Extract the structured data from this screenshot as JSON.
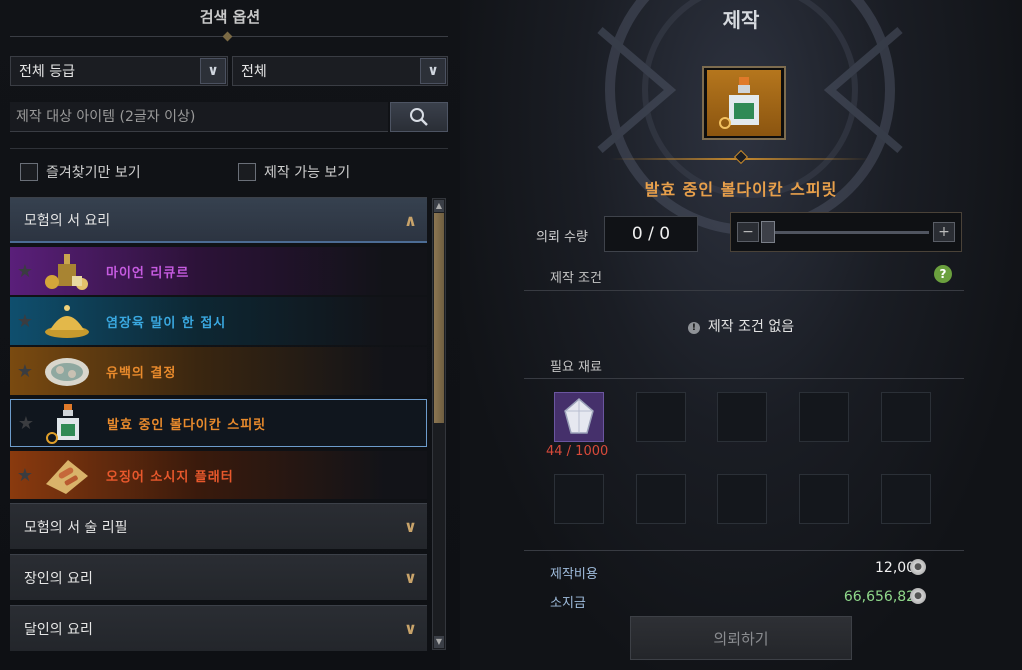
{
  "left_panel": {
    "title": "검색 옵션",
    "grade_dropdown": "전체 등급",
    "type_dropdown": "전체",
    "search_placeholder": "제작 대상 아이템 (2글자 이상)",
    "favorites_only_label": "즐겨찾기만 보기",
    "craftable_only_label": "제작 가능 보기",
    "categories": [
      {
        "label": "모험의 서 요리",
        "expanded": true
      },
      {
        "label": "모험의 서 술 리필",
        "expanded": false
      },
      {
        "label": "장인의 요리",
        "expanded": false
      },
      {
        "label": "달인의 요리",
        "expanded": false
      }
    ],
    "items": [
      {
        "name": "마이언 리큐르",
        "color": "#c65be0",
        "icon": "liquor-bottles-icon"
      },
      {
        "name": "염장육 말이 한 접시",
        "color": "#3aa8e0",
        "icon": "golden-dome-plate-icon"
      },
      {
        "name": "유백의 결정",
        "color": "#e88a2c",
        "icon": "seafood-plate-icon"
      },
      {
        "name": "발효 중인 볼다이칸 스피릿",
        "color": "#e88a2c",
        "icon": "potion-bottle-icon",
        "selected": true
      },
      {
        "name": "오징어 소시지 플래터",
        "color": "#e8582c",
        "icon": "sausage-platter-icon"
      }
    ]
  },
  "right_panel": {
    "title": "제작",
    "item_name": "발효 중인 볼다이칸 스피릿",
    "quantity_label": "의뢰 수량",
    "quantity_value": "0 / 0",
    "craft_conditions_label": "제작 조건",
    "no_conditions_text": "제작 조건 없음",
    "required_materials_label": "필요 재료",
    "material_count": "44 / 1000",
    "craft_cost_label": "제작비용",
    "craft_cost_value": "12,000",
    "owned_gold_label": "소지금",
    "owned_gold_value": "66,656,822",
    "request_button": "의뢰하기",
    "colors": {
      "accent_gold": "#c88a2c",
      "item_name": "#e8a04b",
      "material_count": "#d84a3a",
      "owned_gold": "#8fd88a"
    }
  }
}
